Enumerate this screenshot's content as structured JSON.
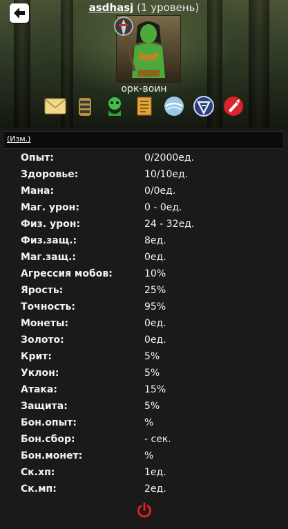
{
  "header": {
    "username": "asdhasj",
    "level": "(1 уровень)",
    "class_name": "орк-воин"
  },
  "edit_link": "(Изм.)",
  "stats": [
    {
      "label": "Опыт:",
      "value": "0/2000ед."
    },
    {
      "label": "Здоровье:",
      "value": "10/10ед."
    },
    {
      "label": "Мана:",
      "value": "0/0ед."
    },
    {
      "label": "Маг. урон:",
      "value": "0 - 0ед."
    },
    {
      "label": "Физ. урон:",
      "value": "24 - 32ед."
    },
    {
      "label": "Физ.защ.:",
      "value": "8ед."
    },
    {
      "label": "Маг.защ.:",
      "value": "0ед."
    },
    {
      "label": "Агрессия мобов:",
      "value": "10%"
    },
    {
      "label": "Ярость:",
      "value": "25%"
    },
    {
      "label": "Точность:",
      "value": "95%"
    },
    {
      "label": "Монеты:",
      "value": "0ед."
    },
    {
      "label": "Золото:",
      "value": "0ед."
    },
    {
      "label": "Крит:",
      "value": "5%"
    },
    {
      "label": "Уклон:",
      "value": "5%"
    },
    {
      "label": "Атака:",
      "value": "15%"
    },
    {
      "label": "Защита:",
      "value": "5%"
    },
    {
      "label": "Бон.опыт:",
      "value": "%"
    },
    {
      "label": "Бон.сбор:",
      "value": "- сек."
    },
    {
      "label": "Бон.монет:",
      "value": "%"
    },
    {
      "label": "Ск.хп:",
      "value": "1ед."
    },
    {
      "label": "Ск.мп:",
      "value": "2ед."
    }
  ],
  "icons": {
    "back": "back-arrow-icon",
    "class_badge": "warrior-class-icon",
    "actions": [
      "mail-icon",
      "inventory-icon",
      "pet-icon",
      "scroll-icon",
      "orb-icon",
      "clan-icon",
      "attack-icon"
    ],
    "logout": "power-icon"
  },
  "colors": {
    "background": "#1a1a1a",
    "text": "#f3f3f3",
    "power": "#e02020"
  }
}
